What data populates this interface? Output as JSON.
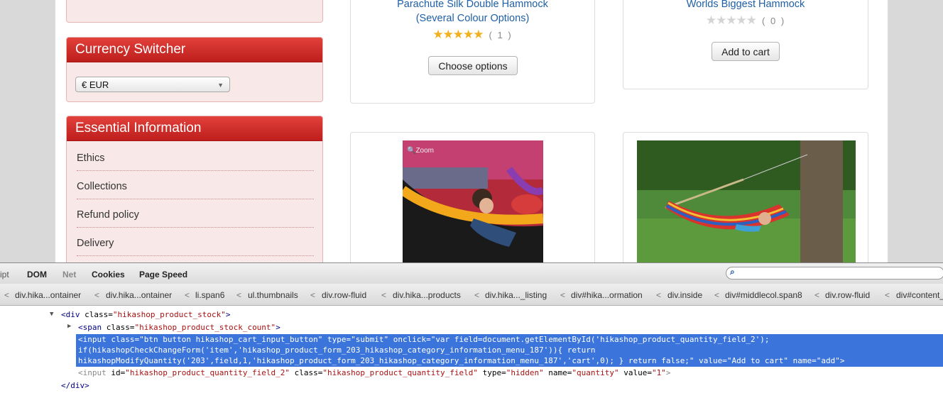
{
  "sidebar": {
    "currency": {
      "title": "Currency Switcher",
      "selected": "€ EUR"
    },
    "info": {
      "title": "Essential Information",
      "items": [
        "Ethics",
        "Collections",
        "Refund policy",
        "Delivery"
      ]
    }
  },
  "products": [
    {
      "name_line1": "Parachute Silk Double Hammock",
      "name_line2": "(Several Colour Options)",
      "rating_count": "( 1 )",
      "rating": 5,
      "button": "Choose options"
    },
    {
      "name_line1": "Worlds Biggest Hammock",
      "rating_count": "( 0 )",
      "rating": 0,
      "button": "Add to cart"
    }
  ],
  "zoom_label": "Zoom",
  "devtools": {
    "menu": [
      "ipt",
      "DOM",
      "Net",
      "Cookies",
      "Page Speed"
    ],
    "breadcrumbs": [
      "div.hika...ontainer",
      "div.hika...ontainer",
      "li.span6",
      "ul.thumbnails",
      "div.row-fluid",
      "div.hika...products",
      "div.hika..._listing",
      "div#hika...ormation",
      "div.inside",
      "div#middlecol.span8",
      "div.row-fluid",
      "div#content_"
    ],
    "html": {
      "line1": {
        "tag": "<div",
        "attr": "class=",
        "val": "\"hikashop_product_stock\"",
        "end": ">"
      },
      "line2": {
        "tag": "<span",
        "attr": "class=",
        "val": "\"hikashop_product_stock_count\"",
        "end": ">"
      },
      "selected_lines": [
        "<input class=\"btn button hikashop_cart_input_button\" type=\"submit\" onclick=\"var field=document.getElementById('hikashop_product_quantity_field_2');",
        "if(hikashopCheckChangeForm('item','hikashop_product_form_203_hikashop_category_information_menu_187')){ return",
        "hikashopModifyQuantity('203',field,1,'hikashop_product_form_203_hikashop_category_information_menu_187','cart',0); } return false;\" value=\"Add to cart\" name=\"add\">"
      ],
      "line6": {
        "tag": "<input",
        "a1": " id=",
        "v1": "\"hikashop_product_quantity_field_2\"",
        "a2": " class=",
        "v2": "\"hikashop_product_quantity_field\"",
        "a3": " type=",
        "v3": "\"hidden\"",
        "a4": " name=",
        "v4": "\"quantity\"",
        "a5": " value=",
        "v5": "\"1\"",
        "end": ">"
      },
      "line7": "</div>"
    }
  }
}
